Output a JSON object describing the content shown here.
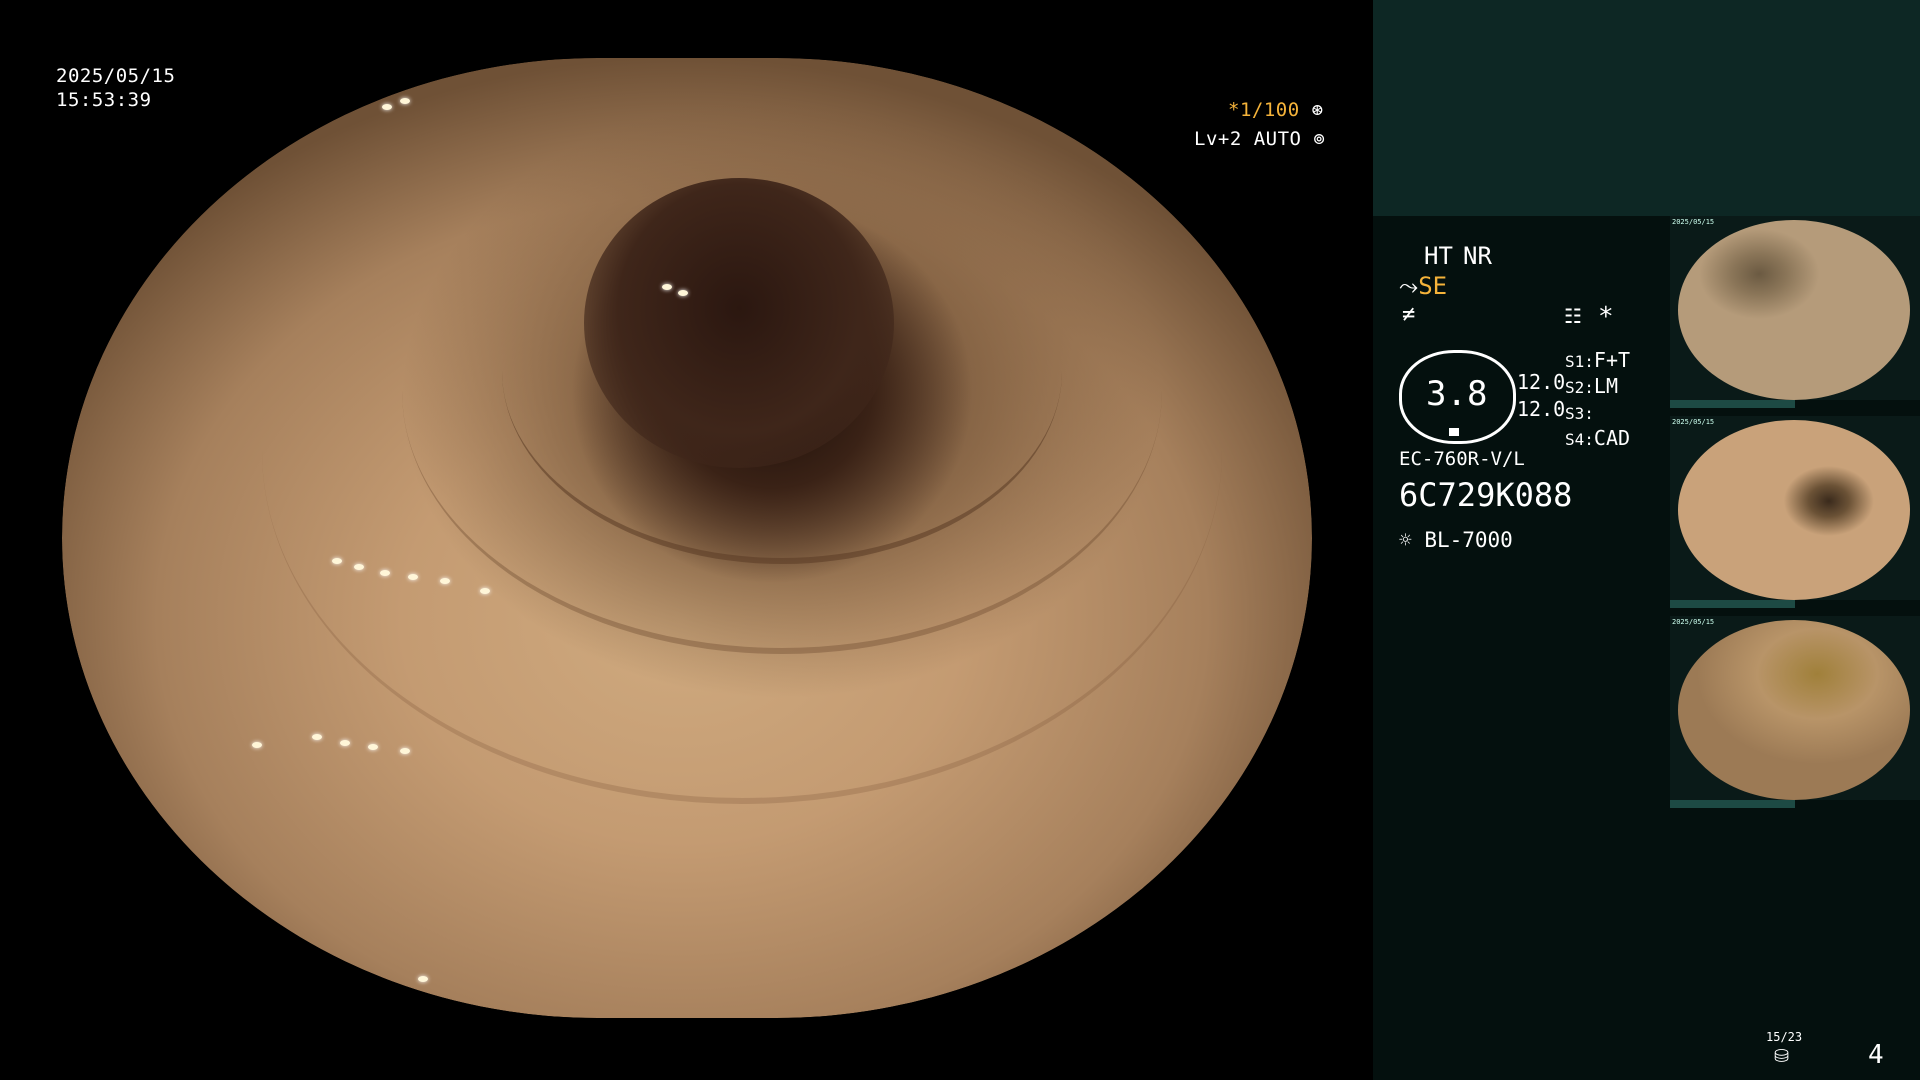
{
  "header": {
    "date": "2025/05/15",
    "time": "15:53:39"
  },
  "overlay": {
    "shutter": "*1/100",
    "shutter_icon": "asterisk-circle-icon",
    "level": "Lv+2 AUTO",
    "level_icon": "iris-icon"
  },
  "status": {
    "ht": "HT",
    "nr": "NR",
    "se": "SE",
    "se_prefix_icon": "enhance-icon",
    "freeze_icon": "no-freeze-icon",
    "menu_icon": "settings-menu-icon",
    "star": "*"
  },
  "gauge": {
    "value": "3.8",
    "reading_1": "12.0",
    "reading_2": "12.0"
  },
  "switches": [
    {
      "key": "S1",
      "value": "F+T"
    },
    {
      "key": "S2",
      "value": "LM"
    },
    {
      "key": "S3",
      "value": ""
    },
    {
      "key": "S4",
      "value": "CAD"
    }
  ],
  "scope": {
    "model": "EC-760R-V/L",
    "serial": "6C729K088"
  },
  "light": {
    "icon": "sun-lamp-icon",
    "source": "BL-7000"
  },
  "thumbnails": [
    {
      "tag": "2025/05/15"
    },
    {
      "tag": "2025/05/15"
    },
    {
      "tag": "2025/05/15"
    }
  ],
  "footer": {
    "counter": "15/23",
    "disk_icon": "storage-disk-icon",
    "page": "4"
  },
  "colors": {
    "accent": "#f5b33a",
    "sidebar_bg": "#04100e",
    "sidebar_top": "#0d2724",
    "thumb_bar": "#1d4a44"
  }
}
